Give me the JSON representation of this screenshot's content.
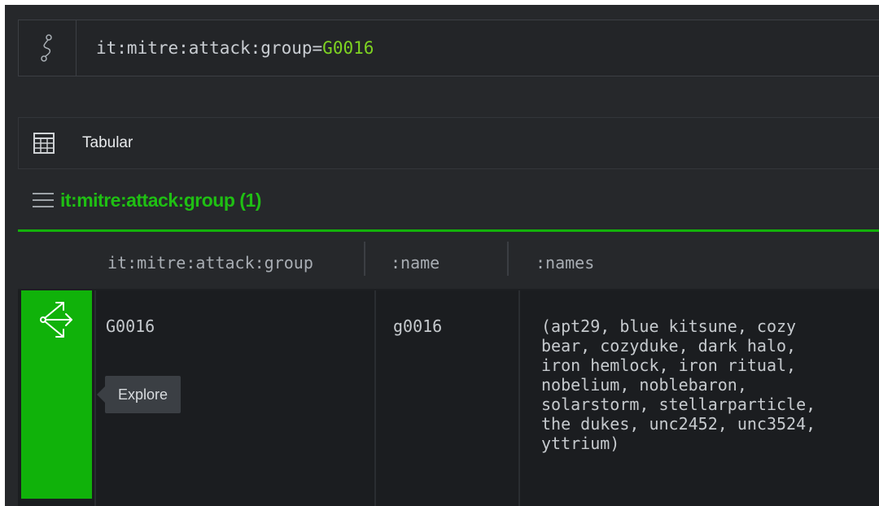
{
  "query": {
    "icon": "graph-path-icon",
    "prefix": "it:mitre:attack:group",
    "operator": "=",
    "value": "G0016",
    "value_color": "#7ed321"
  },
  "view": {
    "icon": "table-icon",
    "label": "Tabular"
  },
  "group": {
    "icon": "hamburger-icon",
    "title": "it:mitre:attack:group (1)",
    "title_color": "#1fbf13"
  },
  "table": {
    "columns": [
      "it:mitre:attack:group",
      ":name",
      ":names"
    ],
    "rows": [
      {
        "explore_icon": "explore-arrows-icon",
        "group": "G0016",
        "name": "g0016",
        "names": "(apt29, blue kitsune, cozy\nbear, cozyduke, dark halo,\niron hemlock, iron ritual,\nnobelium, noblebaron,\nsolarstorm, stellarparticle,\nthe dukes, unc2452, unc3524,\nyttrium)"
      }
    ]
  },
  "tooltip": {
    "label": "Explore"
  },
  "colors": {
    "accent_green": "#10b20a",
    "background": "#26282b",
    "row_background": "#1b1d20"
  }
}
